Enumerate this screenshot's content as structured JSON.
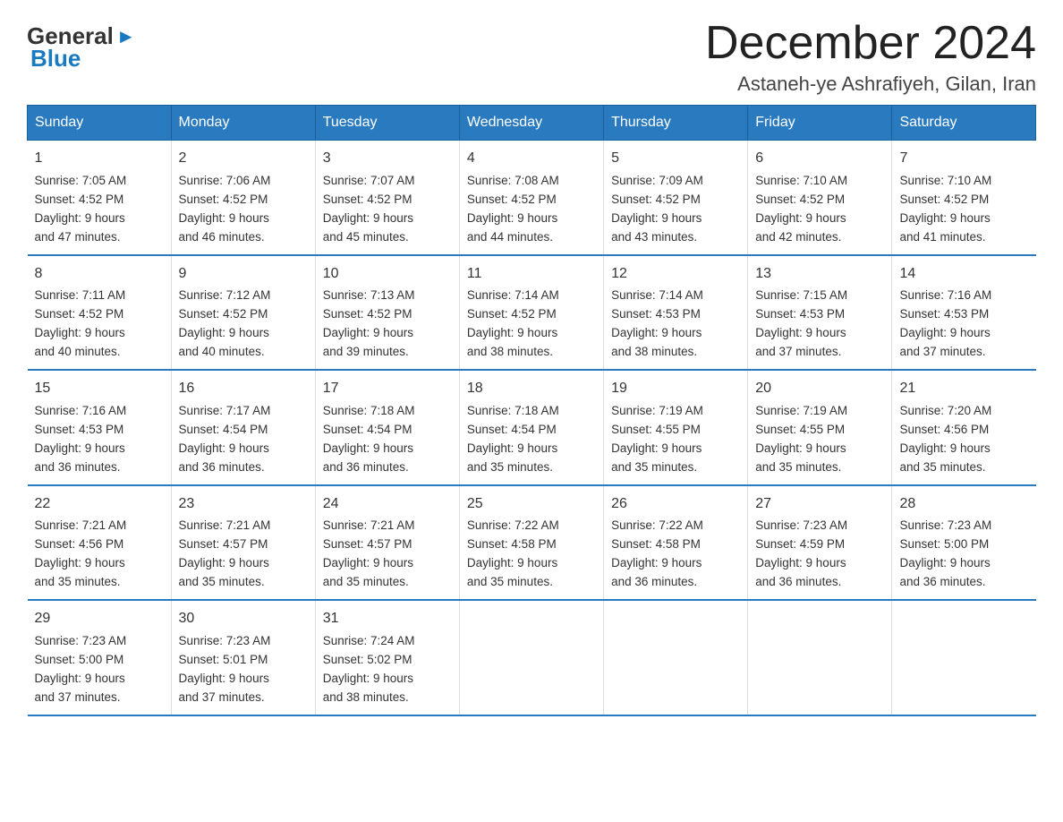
{
  "header": {
    "logo_general": "General",
    "logo_blue": "Blue",
    "title": "December 2024",
    "subtitle": "Astaneh-ye Ashrafiyeh, Gilan, Iran"
  },
  "days_of_week": [
    "Sunday",
    "Monday",
    "Tuesday",
    "Wednesday",
    "Thursday",
    "Friday",
    "Saturday"
  ],
  "weeks": [
    [
      {
        "day": "1",
        "sunrise": "Sunrise: 7:05 AM",
        "sunset": "Sunset: 4:52 PM",
        "daylight": "Daylight: 9 hours",
        "daylight2": "and 47 minutes."
      },
      {
        "day": "2",
        "sunrise": "Sunrise: 7:06 AM",
        "sunset": "Sunset: 4:52 PM",
        "daylight": "Daylight: 9 hours",
        "daylight2": "and 46 minutes."
      },
      {
        "day": "3",
        "sunrise": "Sunrise: 7:07 AM",
        "sunset": "Sunset: 4:52 PM",
        "daylight": "Daylight: 9 hours",
        "daylight2": "and 45 minutes."
      },
      {
        "day": "4",
        "sunrise": "Sunrise: 7:08 AM",
        "sunset": "Sunset: 4:52 PM",
        "daylight": "Daylight: 9 hours",
        "daylight2": "and 44 minutes."
      },
      {
        "day": "5",
        "sunrise": "Sunrise: 7:09 AM",
        "sunset": "Sunset: 4:52 PM",
        "daylight": "Daylight: 9 hours",
        "daylight2": "and 43 minutes."
      },
      {
        "day": "6",
        "sunrise": "Sunrise: 7:10 AM",
        "sunset": "Sunset: 4:52 PM",
        "daylight": "Daylight: 9 hours",
        "daylight2": "and 42 minutes."
      },
      {
        "day": "7",
        "sunrise": "Sunrise: 7:10 AM",
        "sunset": "Sunset: 4:52 PM",
        "daylight": "Daylight: 9 hours",
        "daylight2": "and 41 minutes."
      }
    ],
    [
      {
        "day": "8",
        "sunrise": "Sunrise: 7:11 AM",
        "sunset": "Sunset: 4:52 PM",
        "daylight": "Daylight: 9 hours",
        "daylight2": "and 40 minutes."
      },
      {
        "day": "9",
        "sunrise": "Sunrise: 7:12 AM",
        "sunset": "Sunset: 4:52 PM",
        "daylight": "Daylight: 9 hours",
        "daylight2": "and 40 minutes."
      },
      {
        "day": "10",
        "sunrise": "Sunrise: 7:13 AM",
        "sunset": "Sunset: 4:52 PM",
        "daylight": "Daylight: 9 hours",
        "daylight2": "and 39 minutes."
      },
      {
        "day": "11",
        "sunrise": "Sunrise: 7:14 AM",
        "sunset": "Sunset: 4:52 PM",
        "daylight": "Daylight: 9 hours",
        "daylight2": "and 38 minutes."
      },
      {
        "day": "12",
        "sunrise": "Sunrise: 7:14 AM",
        "sunset": "Sunset: 4:53 PM",
        "daylight": "Daylight: 9 hours",
        "daylight2": "and 38 minutes."
      },
      {
        "day": "13",
        "sunrise": "Sunrise: 7:15 AM",
        "sunset": "Sunset: 4:53 PM",
        "daylight": "Daylight: 9 hours",
        "daylight2": "and 37 minutes."
      },
      {
        "day": "14",
        "sunrise": "Sunrise: 7:16 AM",
        "sunset": "Sunset: 4:53 PM",
        "daylight": "Daylight: 9 hours",
        "daylight2": "and 37 minutes."
      }
    ],
    [
      {
        "day": "15",
        "sunrise": "Sunrise: 7:16 AM",
        "sunset": "Sunset: 4:53 PM",
        "daylight": "Daylight: 9 hours",
        "daylight2": "and 36 minutes."
      },
      {
        "day": "16",
        "sunrise": "Sunrise: 7:17 AM",
        "sunset": "Sunset: 4:54 PM",
        "daylight": "Daylight: 9 hours",
        "daylight2": "and 36 minutes."
      },
      {
        "day": "17",
        "sunrise": "Sunrise: 7:18 AM",
        "sunset": "Sunset: 4:54 PM",
        "daylight": "Daylight: 9 hours",
        "daylight2": "and 36 minutes."
      },
      {
        "day": "18",
        "sunrise": "Sunrise: 7:18 AM",
        "sunset": "Sunset: 4:54 PM",
        "daylight": "Daylight: 9 hours",
        "daylight2": "and 35 minutes."
      },
      {
        "day": "19",
        "sunrise": "Sunrise: 7:19 AM",
        "sunset": "Sunset: 4:55 PM",
        "daylight": "Daylight: 9 hours",
        "daylight2": "and 35 minutes."
      },
      {
        "day": "20",
        "sunrise": "Sunrise: 7:19 AM",
        "sunset": "Sunset: 4:55 PM",
        "daylight": "Daylight: 9 hours",
        "daylight2": "and 35 minutes."
      },
      {
        "day": "21",
        "sunrise": "Sunrise: 7:20 AM",
        "sunset": "Sunset: 4:56 PM",
        "daylight": "Daylight: 9 hours",
        "daylight2": "and 35 minutes."
      }
    ],
    [
      {
        "day": "22",
        "sunrise": "Sunrise: 7:21 AM",
        "sunset": "Sunset: 4:56 PM",
        "daylight": "Daylight: 9 hours",
        "daylight2": "and 35 minutes."
      },
      {
        "day": "23",
        "sunrise": "Sunrise: 7:21 AM",
        "sunset": "Sunset: 4:57 PM",
        "daylight": "Daylight: 9 hours",
        "daylight2": "and 35 minutes."
      },
      {
        "day": "24",
        "sunrise": "Sunrise: 7:21 AM",
        "sunset": "Sunset: 4:57 PM",
        "daylight": "Daylight: 9 hours",
        "daylight2": "and 35 minutes."
      },
      {
        "day": "25",
        "sunrise": "Sunrise: 7:22 AM",
        "sunset": "Sunset: 4:58 PM",
        "daylight": "Daylight: 9 hours",
        "daylight2": "and 35 minutes."
      },
      {
        "day": "26",
        "sunrise": "Sunrise: 7:22 AM",
        "sunset": "Sunset: 4:58 PM",
        "daylight": "Daylight: 9 hours",
        "daylight2": "and 36 minutes."
      },
      {
        "day": "27",
        "sunrise": "Sunrise: 7:23 AM",
        "sunset": "Sunset: 4:59 PM",
        "daylight": "Daylight: 9 hours",
        "daylight2": "and 36 minutes."
      },
      {
        "day": "28",
        "sunrise": "Sunrise: 7:23 AM",
        "sunset": "Sunset: 5:00 PM",
        "daylight": "Daylight: 9 hours",
        "daylight2": "and 36 minutes."
      }
    ],
    [
      {
        "day": "29",
        "sunrise": "Sunrise: 7:23 AM",
        "sunset": "Sunset: 5:00 PM",
        "daylight": "Daylight: 9 hours",
        "daylight2": "and 37 minutes."
      },
      {
        "day": "30",
        "sunrise": "Sunrise: 7:23 AM",
        "sunset": "Sunset: 5:01 PM",
        "daylight": "Daylight: 9 hours",
        "daylight2": "and 37 minutes."
      },
      {
        "day": "31",
        "sunrise": "Sunrise: 7:24 AM",
        "sunset": "Sunset: 5:02 PM",
        "daylight": "Daylight: 9 hours",
        "daylight2": "and 38 minutes."
      },
      null,
      null,
      null,
      null
    ]
  ]
}
